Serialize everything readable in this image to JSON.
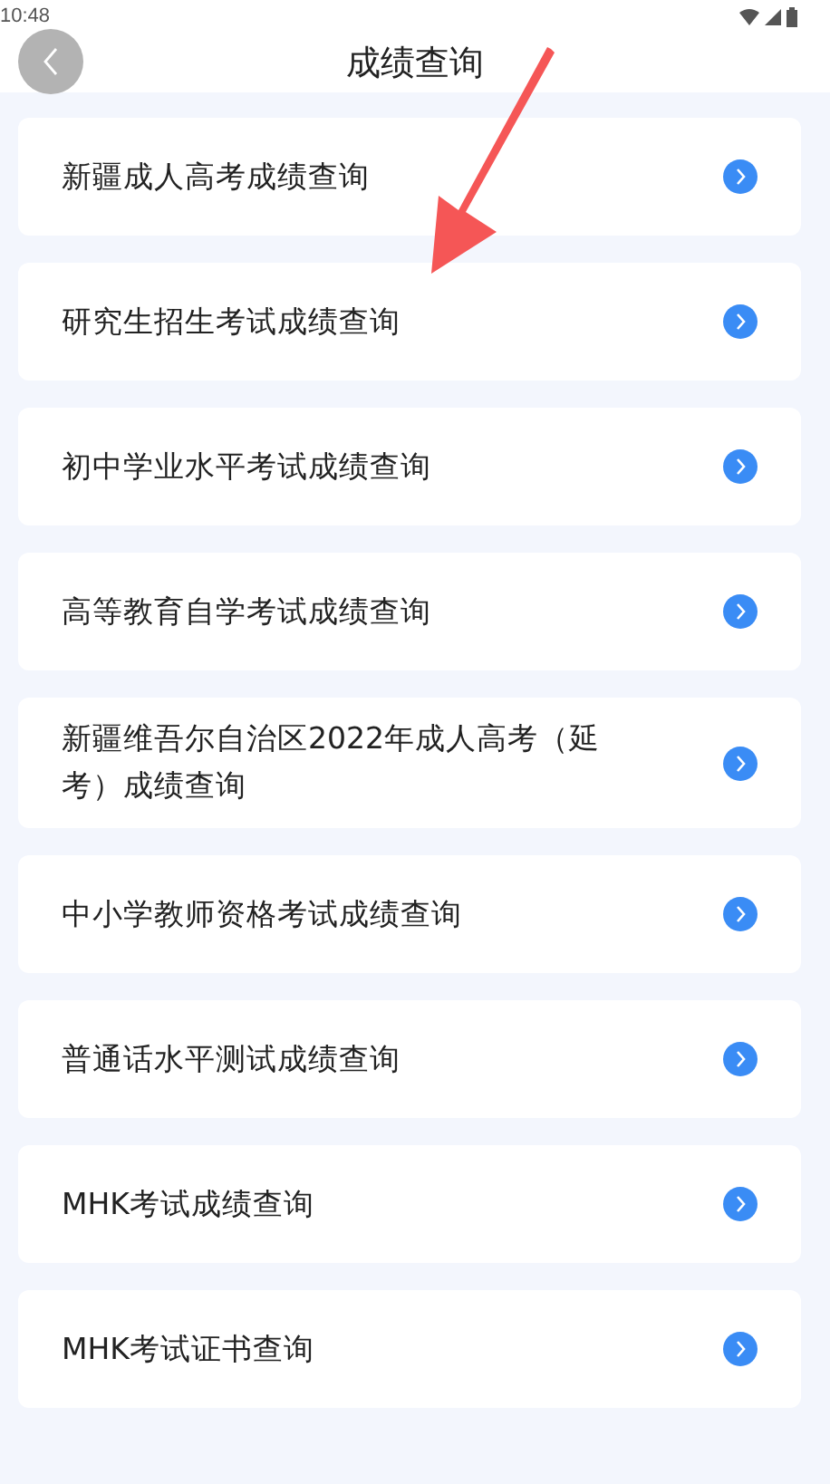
{
  "status_bar": {
    "time": "10:48"
  },
  "header": {
    "title": "成绩查询"
  },
  "items": [
    {
      "label": "新疆成人高考成绩查询"
    },
    {
      "label": "研究生招生考试成绩查询"
    },
    {
      "label": "初中学业水平考试成绩查询"
    },
    {
      "label": "高等教育自学考试成绩查询"
    },
    {
      "label": "新疆维吾尔自治区2022年成人高考（延考）成绩查询"
    },
    {
      "label": "中小学教师资格考试成绩查询"
    },
    {
      "label": "普通话水平测试成绩查询"
    },
    {
      "label": "MHK考试成绩查询"
    },
    {
      "label": "MHK考试证书查询"
    }
  ]
}
